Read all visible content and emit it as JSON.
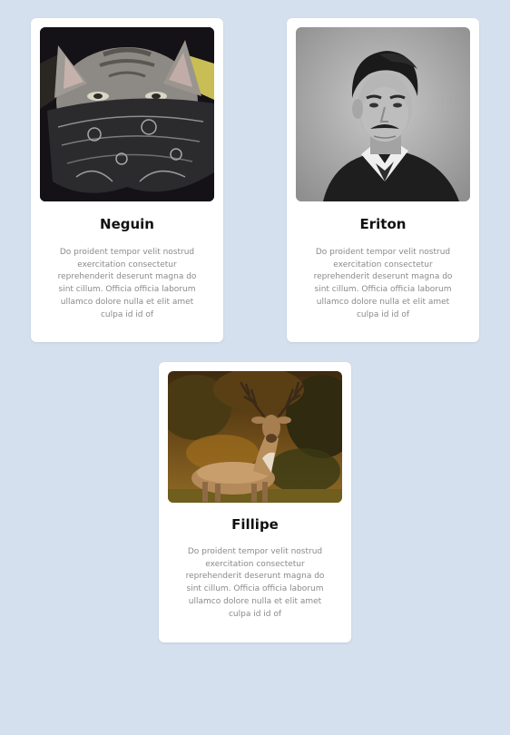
{
  "cards": [
    {
      "name": "Neguin",
      "description": "Do proident tempor velit nostrud exercitation consectetur reprehenderit deserunt magna do sint cillum. Officia officia laborum ullamco dolore nulla et elit amet culpa id id of",
      "image": "photo of a cat wearing a paisley bandana"
    },
    {
      "name": "Eriton",
      "description": "Do proident tempor velit nostrud exercitation consectetur reprehenderit deserunt magna do sint cillum. Officia officia laborum ullamco dolore nulla et elit amet culpa id id of",
      "image": "black and white portrait of a man with a mustache"
    },
    {
      "name": "Fillipe",
      "description": "Do proident tempor velit nostrud exercitation consectetur reprehenderit deserunt magna do sint cillum. Officia officia laborum ullamco dolore nulla et elit amet culpa id id of",
      "image": "photo of a deer with large antlers in a forest"
    }
  ],
  "colors": {
    "background": "#d5e0ee",
    "card": "#ffffff",
    "title": "#111111",
    "description": "#8a8a8a"
  }
}
